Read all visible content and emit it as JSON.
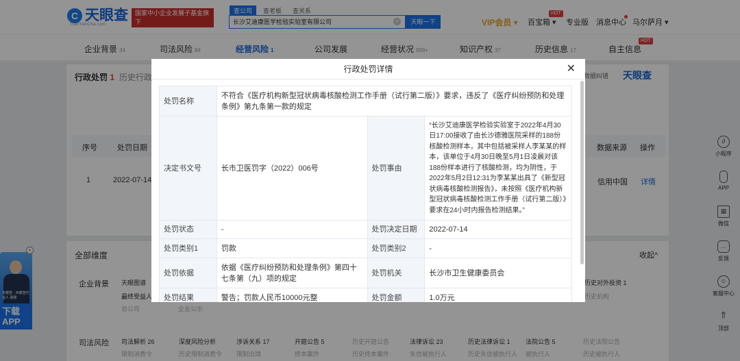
{
  "header": {
    "logo_text": "天眼查",
    "logo_mark": "C",
    "logo_sub": "TianYanCha.com",
    "banner_line1": "国家中小企业发展子基金旗下",
    "banner_line2": "官方备案企业征信机构",
    "search_tabs": [
      "查公司",
      "查老板",
      "查关系"
    ],
    "search_value": "长沙艾迪康医学检验实验室有限公司",
    "search_button": "天眼一下",
    "vip": "VIP会员",
    "nav": [
      "百宝箱",
      "专业版",
      "消息中心",
      "马尔萨月"
    ],
    "hot": "HOT"
  },
  "tabs": [
    {
      "label": "企业背景",
      "count": "34"
    },
    {
      "label": "司法风险",
      "count": "84"
    },
    {
      "label": "经营风险",
      "count": "1"
    },
    {
      "label": "公司发展",
      "count": ""
    },
    {
      "label": "经营状况",
      "count": "999+"
    },
    {
      "label": "知识产权",
      "count": "37"
    },
    {
      "label": "历史信息",
      "count": "17"
    },
    {
      "label": "自主信息",
      "count": ""
    }
  ],
  "background": {
    "section_title": "行政处罚",
    "section_count": "1",
    "section_tab2": "历史行政处",
    "data_error": "数据纠错",
    "watermark": "天眼查",
    "table_headers": [
      "序号",
      "处罚日期",
      "数据来源",
      "操作"
    ],
    "row": {
      "index": "1",
      "date": "2022-07-14",
      "source": "信用中国",
      "action": "详情"
    },
    "all_dims": "全部维度",
    "collapse": "收起",
    "dim_row1_label": "企业背景",
    "dim_row1_items": [
      "天眼图谱",
      "最终受益人",
      "总公司"
    ],
    "dim_row1_right": [
      "历史对外投资 1",
      "历史机构"
    ],
    "dim_row1_mid": [
      "企业公示"
    ],
    "dim_row2_label": "司法风险",
    "dim_row2_items": [
      "司法解析 26",
      "深度风险分析",
      "涉诉关系 17",
      "开庭公告 5",
      "历史开庭公告",
      "法律诉讼 23",
      "历史法律诉讼 1",
      "法院公告 5",
      "历史法院公告"
    ],
    "dim_row2_sub": [
      "限制消费令",
      "历史限制消费令",
      "限制出境",
      "终本案件",
      "历史终本案件",
      "失信被执行人",
      "历史失信被执行人",
      "被执行人",
      "历史被执行人"
    ]
  },
  "sidebar": [
    "小程序",
    "APP",
    "微信",
    "反馈",
    "客服中心",
    "顶部"
  ],
  "promo": {
    "cta_line1": "下载",
    "cta_line2": "APP",
    "text": "天眼查 · 天眼查代言人 吴刚"
  },
  "modal": {
    "title": "行政处罚详情",
    "rows": [
      {
        "label": "处罚名称",
        "value": "不符合《医疗机构新型冠状病毒核酸检测工作手册（试行第二版）》要求，违反了《医疗纠纷预防和处理条例》第九条第一款的规定"
      },
      {
        "label": "决定书文号",
        "value": "长市卫医罚字（2022）006号",
        "label2": "处罚事由",
        "value2": "“长沙艾迪康医学检验实验室于2022年4月30日17:00接收了由长沙德雅医院采样的188份核酸检测样本，其中包括被采样人李某某的样本，该单位于4月30日晚至5月1日凌晨对该188份样本进行了核酸检测，均为阴性，于2022年5月2日12:31为李某某出具了《新型冠状病毒核酸检测报告》，未按照《医疗机构新型冠状病毒核酸检测工作手册（试行第二版）》要求在24小时内报告检测结果。”"
      },
      {
        "label": "处罚状态",
        "value": "-",
        "label2": "处罚决定日期",
        "value2": "2022-07-14"
      },
      {
        "label": "处罚类别1",
        "value": "罚款",
        "label2": "处罚类别2",
        "value2": "-"
      },
      {
        "label": "处罚依据",
        "value": "依据《医疗纠纷预防和处理条例》第四十七条第（九）项的规定",
        "label2": "处罚机关",
        "value2": "长沙市卫生健康委员会"
      },
      {
        "label": "处罚结果",
        "value": "警告；罚款人民币10000元整",
        "label2": "处罚金额",
        "value2": "1.0万元"
      }
    ]
  }
}
